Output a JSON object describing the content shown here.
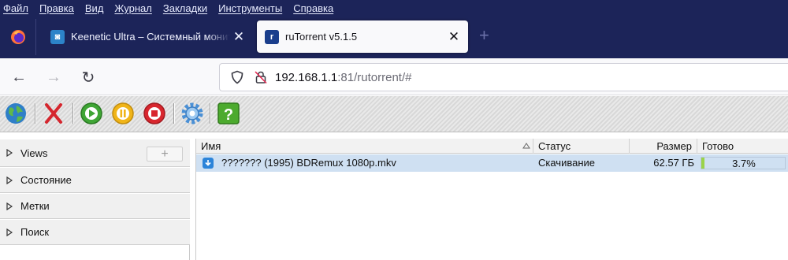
{
  "menu": {
    "items": [
      "Файл",
      "Правка",
      "Вид",
      "Журнал",
      "Закладки",
      "Инструменты",
      "Справка"
    ]
  },
  "tabs": [
    {
      "title": "Keenetic Ultra – Системный монитор",
      "favicon": "keenetic-icon",
      "active": false,
      "close": "✕"
    },
    {
      "title": "ruTorrent v5.1.5",
      "favicon": "rutorrent-icon",
      "active": true,
      "close": "✕"
    }
  ],
  "new_tab": "+",
  "navbar": {
    "back": "←",
    "forward": "→",
    "reload": "↻",
    "url_host": "192.168.1.1",
    "url_rest": ":81/rutorrent/#"
  },
  "toolbar": {
    "icons": [
      "add-torrent-icon",
      "remove-icon",
      "start-icon",
      "pause-icon",
      "stop-icon",
      "settings-icon",
      "help-icon"
    ]
  },
  "left_panel": {
    "views_label": "Views",
    "views_add": "+",
    "state_label": "Состояние",
    "labels_label": "Метки",
    "search_label": "Поиск"
  },
  "table": {
    "headers": {
      "name": "Имя",
      "status": "Статус",
      "size": "Размер",
      "done": "Готово"
    },
    "rows": [
      {
        "name": "??????? (1995) BDRemux 1080p.mkv",
        "status": "Скачивание",
        "size": "62.57 ГБ",
        "done": "3.7%",
        "done_fraction": 0.037
      }
    ]
  },
  "colors": {
    "chrome_dark": "#1c2459",
    "row_selected": "#cfe0f2",
    "progress_fill": "#9ad34a"
  }
}
